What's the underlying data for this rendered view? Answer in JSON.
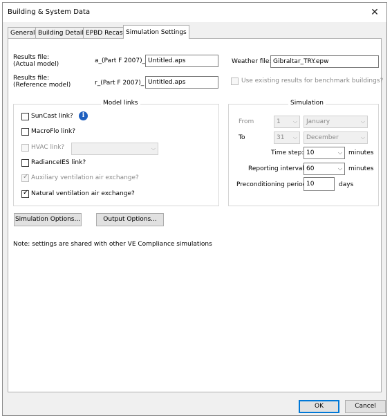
{
  "window": {
    "title": "Building & System Data",
    "close_glyph": "✕"
  },
  "tabs": [
    {
      "label": "General"
    },
    {
      "label": "Building Details"
    },
    {
      "label": "EPBD Recast"
    },
    {
      "label": "Simulation Settings",
      "active": true
    }
  ],
  "results": {
    "actual_label_line1": "Results file:",
    "actual_label_line2": "(Actual model)",
    "actual_prefix": "a_(Part F 2007)_",
    "actual_value": "Untitled.aps",
    "reference_label_line1": "Results file:",
    "reference_label_line2": "(Reference model)",
    "reference_prefix": "r_(Part F 2007)_",
    "reference_value": "Untitled.aps"
  },
  "weather": {
    "label": "Weather file:",
    "value": "Gibraltar_TRY.epw",
    "benchmark_label": "Use existing results for benchmark buildings?"
  },
  "model_links": {
    "title": "Model links",
    "suncast": "SunCast link?",
    "macroflo": "MacroFlo link?",
    "hvac": "HVAC link?",
    "radiance": "RadianceIES link?",
    "aux_vent": "Auxiliary ventilation air exchange?",
    "nat_vent": "Natural ventilation air exchange?"
  },
  "simulation": {
    "title": "Simulation",
    "from_label": "From",
    "from_day": "1",
    "from_month": "January",
    "to_label": "To",
    "to_day": "31",
    "to_month": "December",
    "timestep_label": "Time step:",
    "timestep_value": "10",
    "timestep_unit": "minutes",
    "reporting_label": "Reporting interval:",
    "reporting_value": "60",
    "reporting_unit": "minutes",
    "precond_label": "Preconditioning period:",
    "precond_value": "10",
    "precond_unit": "days"
  },
  "buttons": {
    "sim_options": "Simulation Options...",
    "output_options": "Output Options...",
    "ok": "OK",
    "cancel": "Cancel"
  },
  "note": "Note: settings are shared with other VE Compliance simulations",
  "icons": {
    "checkmark": "✓",
    "dropdown": "⌵",
    "info": "i"
  }
}
